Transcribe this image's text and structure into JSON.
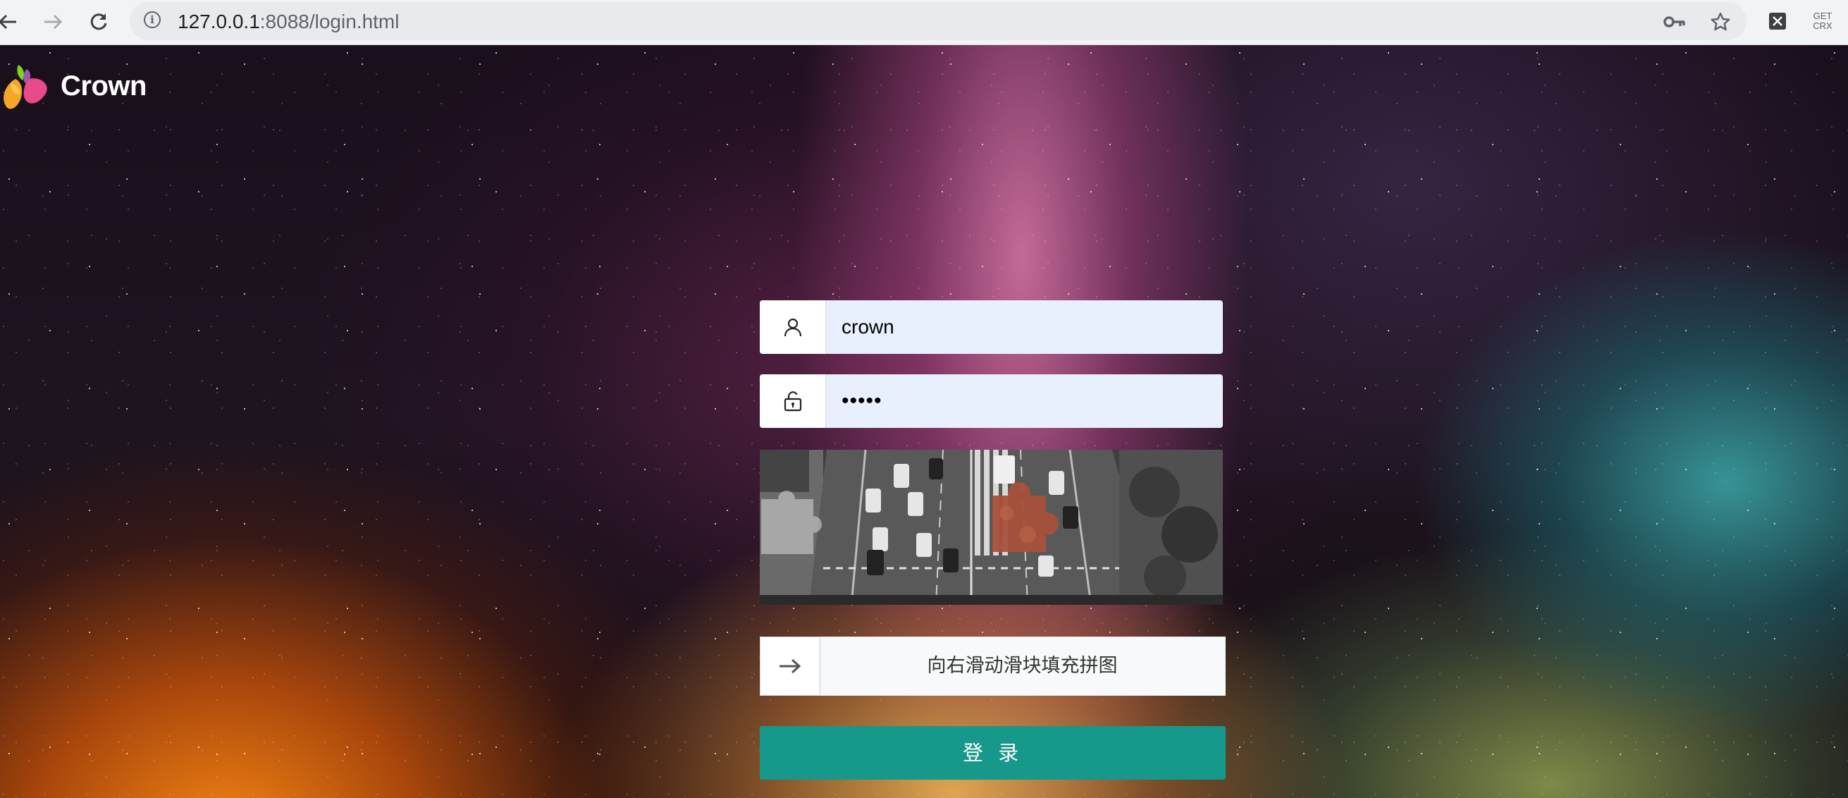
{
  "browser": {
    "url_host": "127.0.0.1",
    "url_rest": ":8088/login.html",
    "extension_crx_label_line1": "GET",
    "extension_crx_label_line2": "CRX",
    "icons": [
      "back-icon",
      "forward-icon",
      "reload-icon",
      "site-info-icon",
      "key-icon",
      "star-icon",
      "excel-extension-icon",
      "get-crx-extension-icon"
    ]
  },
  "brand": {
    "name": "Crown",
    "logo_colors": [
      "#f5a623",
      "#e94b8a",
      "#7ed321",
      "#9b59b6"
    ]
  },
  "form": {
    "username_value": "crown",
    "password_value": "•••••",
    "slider_hint": "向右滑动滑块填充拼图",
    "login_label": "登 录",
    "accent_color": "#16988a",
    "autofill_bg": "#e8f0fe"
  }
}
